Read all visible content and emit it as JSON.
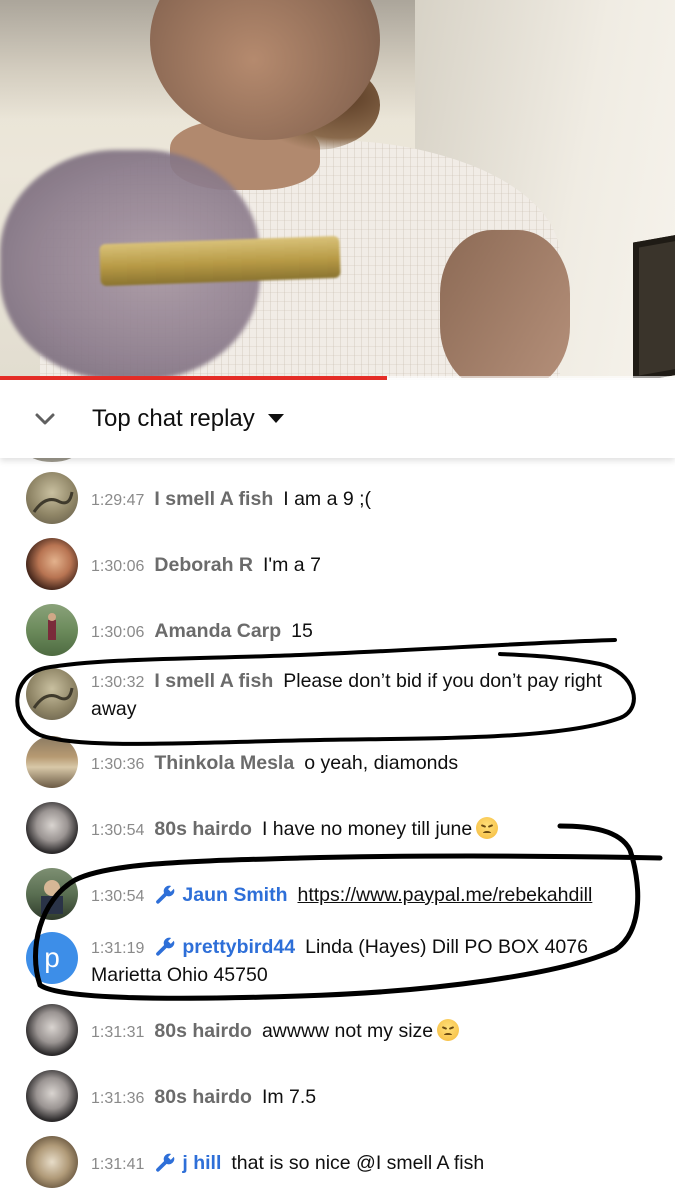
{
  "video": {
    "progress_fraction": 0.573
  },
  "chat_header": {
    "title": "Top chat replay",
    "collapse_icon": "chevron-down-icon",
    "dropdown_icon": "caret-down-icon"
  },
  "colors": {
    "progress": "#e52d27",
    "moderator_name": "#2e6fd8",
    "author_name": "#6b6b6b",
    "timestamp": "#8a8a8a",
    "letter_avatar": "#3d8ee8"
  },
  "messages": [
    {
      "time": "1:29:47",
      "author": "I smell A fish",
      "text": "I am a 9 ;(",
      "moderator": false
    },
    {
      "time": "1:30:06",
      "author": "Deborah R",
      "text": "I'm a 7",
      "moderator": false
    },
    {
      "time": "1:30:06",
      "author": "Amanda Carp",
      "text": "15",
      "moderator": false
    },
    {
      "time": "1:30:32",
      "author": "I smell A fish",
      "text": "Please don’t bid if you don’t pay right away",
      "moderator": false
    },
    {
      "time": "1:30:36",
      "author": "Thinkola Mesla",
      "text": "o yeah, diamonds",
      "moderator": false
    },
    {
      "time": "1:30:54",
      "author": "80s hairdo",
      "text": "I have no money till june",
      "moderator": false,
      "emoji": "disappointed-face-icon"
    },
    {
      "time": "1:30:54",
      "author": "Jaun Smith",
      "text": "https://www.paypal.me/rebekahdill",
      "moderator": true,
      "is_link": true
    },
    {
      "time": "1:31:19",
      "author": "prettybird44",
      "text": "Linda (Hayes) Dill PO BOX 4076 Marietta Ohio 45750",
      "moderator": true,
      "avatar_letter": "p"
    },
    {
      "time": "1:31:31",
      "author": "80s hairdo",
      "text": "awwww not my size",
      "moderator": false,
      "emoji": "disappointed-face-icon"
    },
    {
      "time": "1:31:36",
      "author": "80s hairdo",
      "text": "Im 7.5",
      "moderator": false
    },
    {
      "time": "1:31:41",
      "author": "j hill",
      "text": "that is so nice @I smell A fish",
      "moderator": true
    }
  ]
}
